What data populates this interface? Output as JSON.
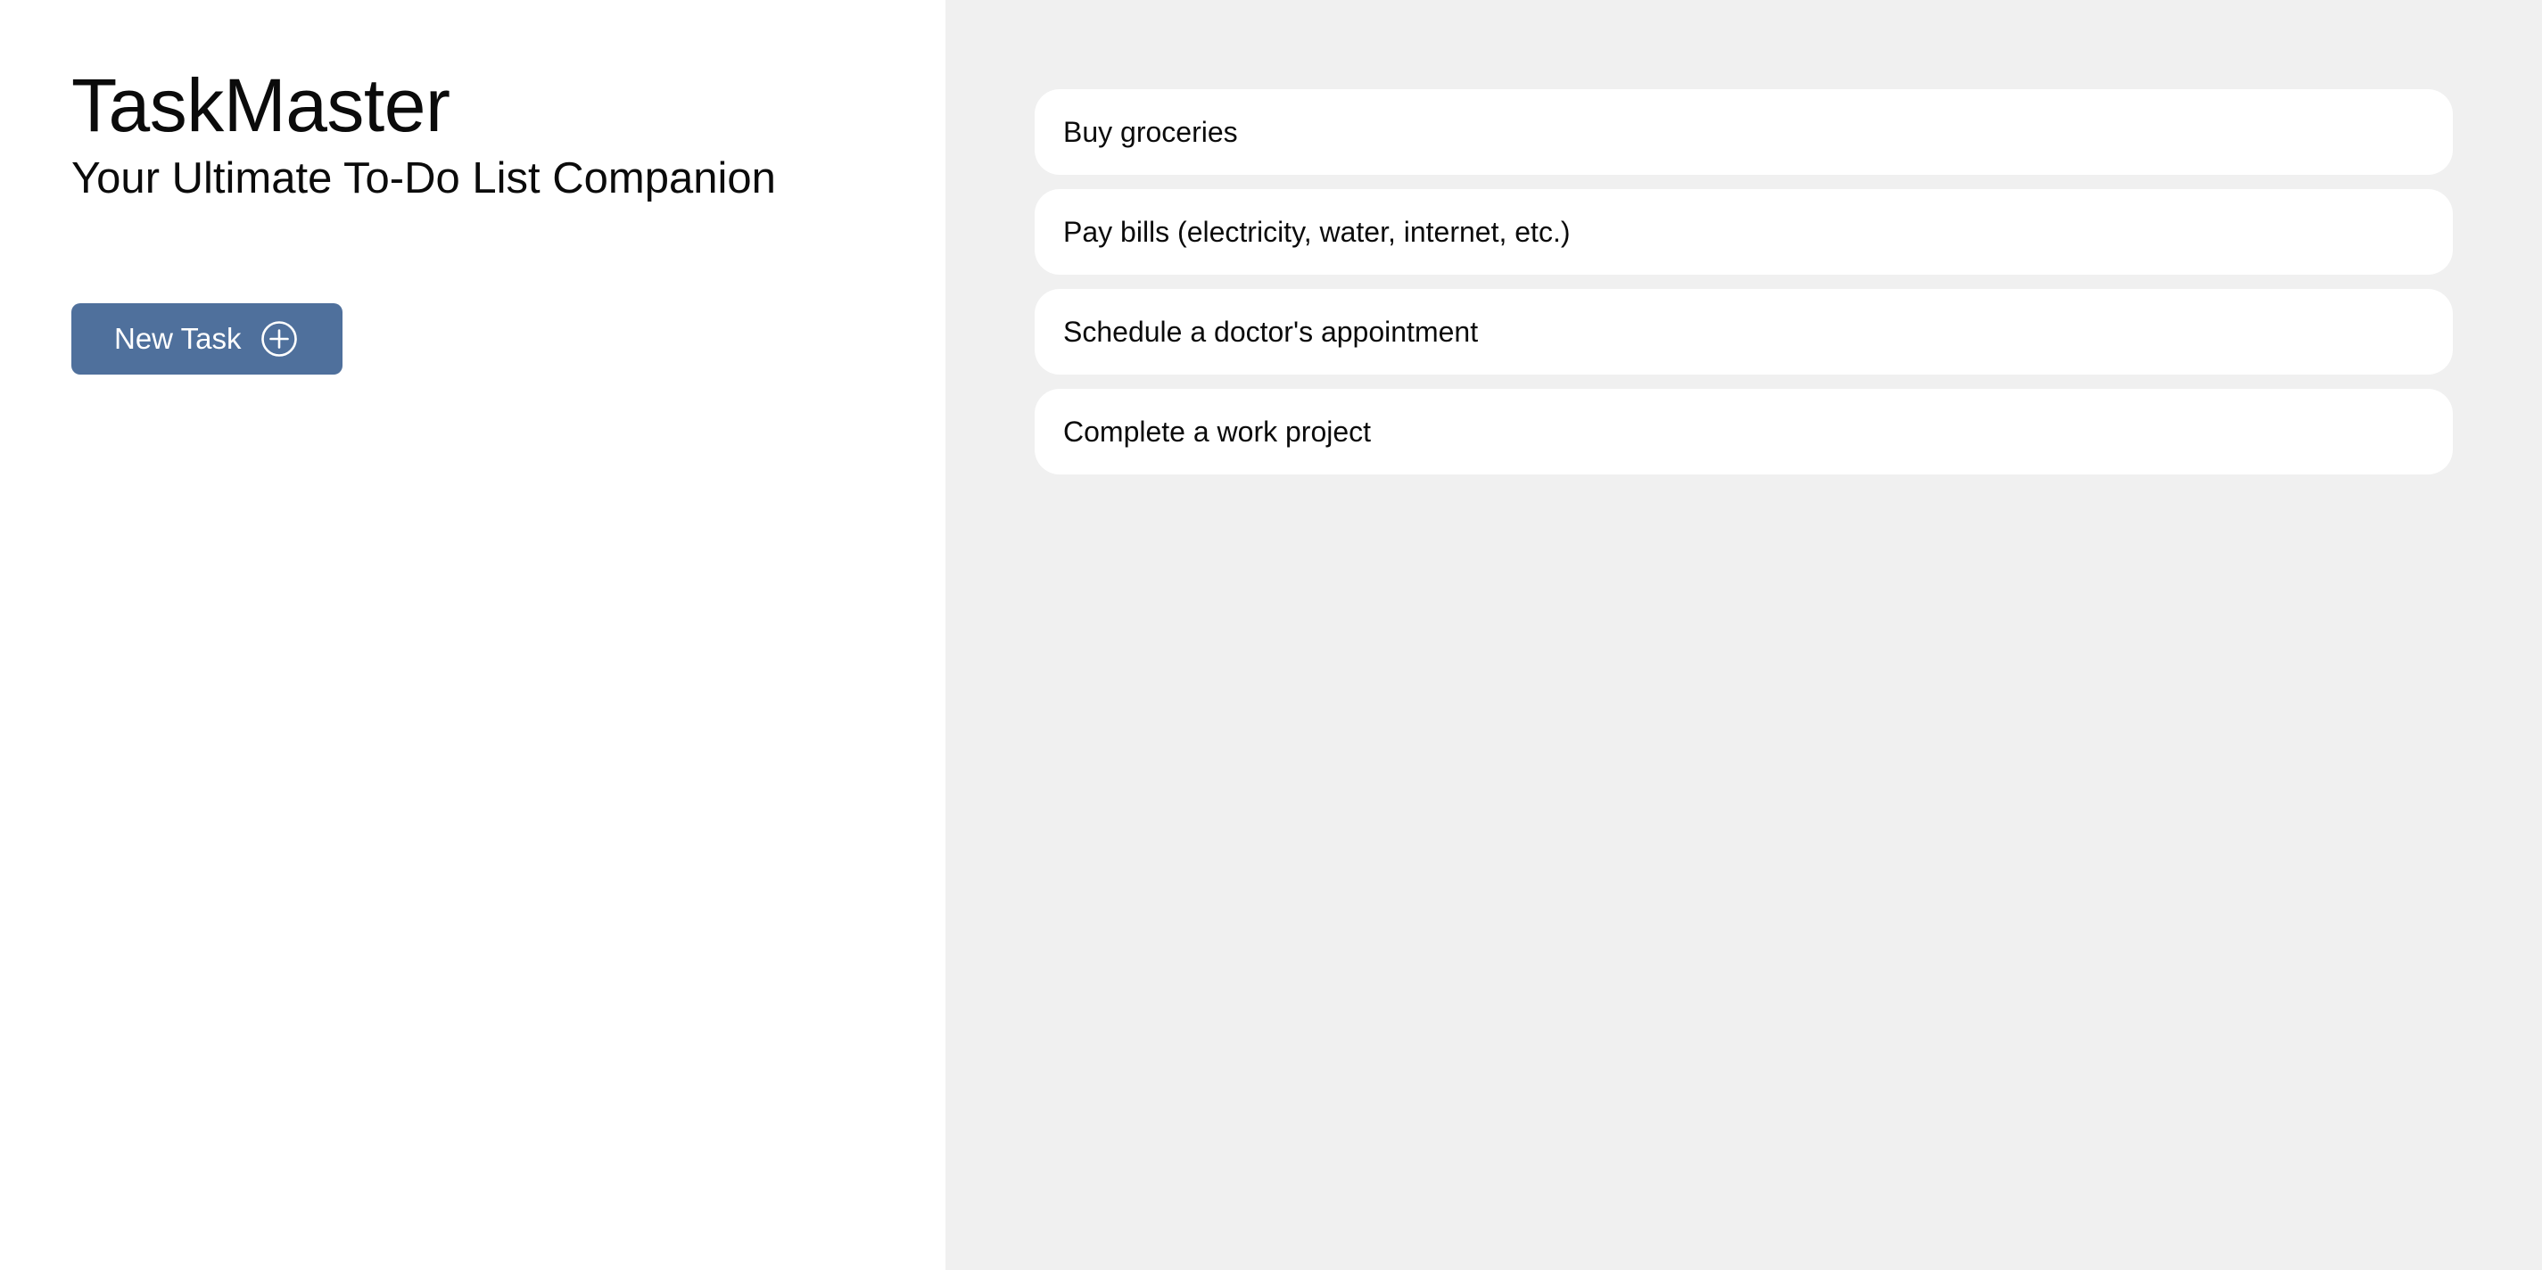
{
  "header": {
    "title": "TaskMaster",
    "subtitle": "Your Ultimate To-Do List Companion"
  },
  "actions": {
    "new_task_label": "New Task",
    "new_task_icon": "plus-circle-icon"
  },
  "tasks": [
    {
      "label": "Buy groceries"
    },
    {
      "label": "Pay bills (electricity, water, internet, etc.)"
    },
    {
      "label": "Schedule a doctor's appointment"
    },
    {
      "label": "Complete a work project"
    }
  ],
  "colors": {
    "accent": "#4f709c",
    "left_background": "#ffffff",
    "right_background": "#f0f0f0",
    "card_background": "#ffffff"
  }
}
